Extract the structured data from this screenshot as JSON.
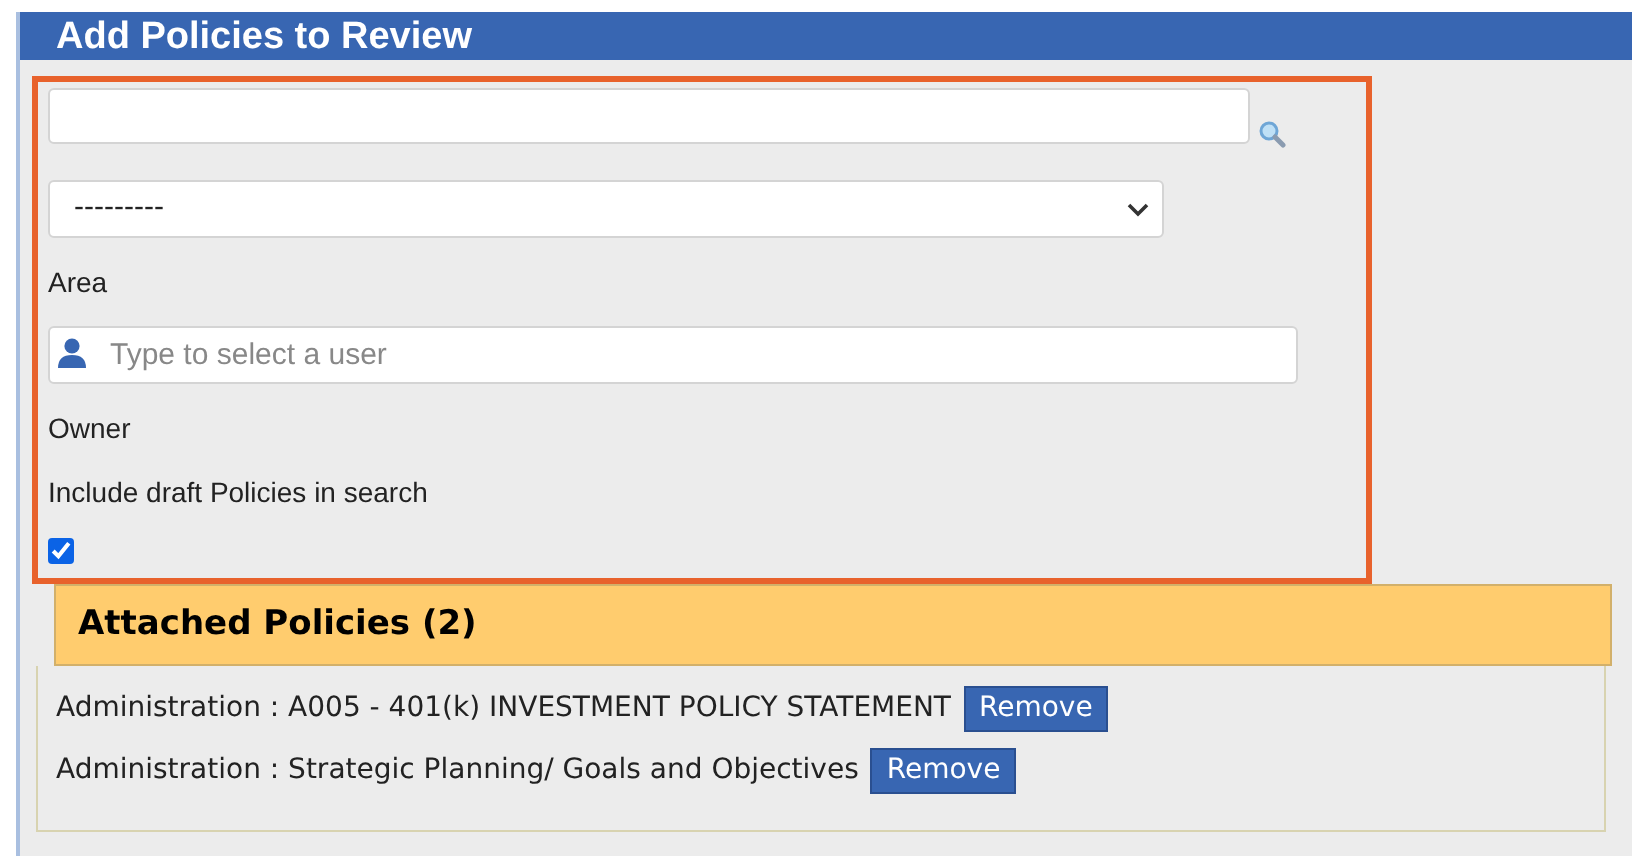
{
  "header": {
    "title": "Add Policies to Review"
  },
  "area": {
    "value": "---------",
    "label": "Area"
  },
  "owner": {
    "placeholder": "Type to select a user",
    "label": "Owner"
  },
  "include_drafts": {
    "label": "Include draft Policies in search",
    "checked": true
  },
  "attached": {
    "title": "Attached Policies (2)",
    "items": [
      {
        "text": "Administration : A005 - 401(k) INVESTMENT POLICY STATEMENT",
        "button": "Remove"
      },
      {
        "text": "Administration : Strategic Planning/ Goals and Objectives",
        "button": "Remove"
      }
    ]
  }
}
